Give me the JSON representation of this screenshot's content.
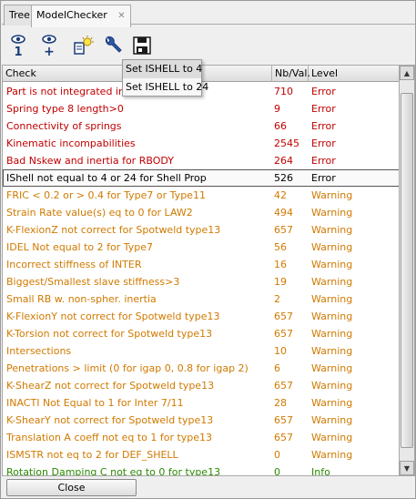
{
  "tabs": [
    {
      "label": "Tree",
      "active": false
    },
    {
      "label": "ModelChecker",
      "active": true,
      "close": "✕"
    }
  ],
  "toolbar": {
    "buttons": [
      {
        "name": "show-one-icon",
        "digit": "1"
      },
      {
        "name": "show-plus-icon",
        "digit": "+"
      },
      {
        "name": "lightbulb-icon"
      },
      {
        "name": "wrench-icon"
      },
      {
        "name": "save-icon"
      }
    ]
  },
  "table": {
    "columns": [
      "Check",
      "Nb/Val.",
      "Level"
    ],
    "rows": [
      {
        "check": "Part is not integrated in rbody",
        "nb": "710",
        "level": "Error",
        "sev": "error"
      },
      {
        "check": "Spring type 8 length>0",
        "nb": "9",
        "level": "Error",
        "sev": "error"
      },
      {
        "check": "Connectivity of springs",
        "nb": "66",
        "level": "Error",
        "sev": "error"
      },
      {
        "check": "Kinematic incompabilities",
        "nb": "2545",
        "level": "Error",
        "sev": "error"
      },
      {
        "check": "Bad Nskew and inertia for RBODY",
        "nb": "264",
        "level": "Error",
        "sev": "error"
      },
      {
        "check": "IShell not equal to 4 or 24 for Shell Prop",
        "nb": "526",
        "level": "Error",
        "sev": "selected",
        "selected": true
      },
      {
        "check": "FRIC < 0.2 or > 0.4 for Type7 or Type11",
        "nb": "42",
        "level": "Warning",
        "sev": "warning"
      },
      {
        "check": "Strain Rate value(s) eq to 0 for LAW2",
        "nb": "494",
        "level": "Warning",
        "sev": "warning"
      },
      {
        "check": "K-FlexionZ not correct for Spotweld type13",
        "nb": "657",
        "level": "Warning",
        "sev": "warning"
      },
      {
        "check": "IDEL Not equal to 2 for Type7",
        "nb": "56",
        "level": "Warning",
        "sev": "warning"
      },
      {
        "check": "Incorrect stiffness of INTER",
        "nb": "16",
        "level": "Warning",
        "sev": "warning"
      },
      {
        "check": "Biggest/Smallest slave stiffness>3",
        "nb": "19",
        "level": "Warning",
        "sev": "warning"
      },
      {
        "check": "Small RB w. non-spher. inertia",
        "nb": "2",
        "level": "Warning",
        "sev": "warning"
      },
      {
        "check": "K-FlexionY not correct for Spotweld type13",
        "nb": "657",
        "level": "Warning",
        "sev": "warning"
      },
      {
        "check": "K-Torsion not correct for Spotweld type13",
        "nb": "657",
        "level": "Warning",
        "sev": "warning"
      },
      {
        "check": "Intersections",
        "nb": "10",
        "level": "Warning",
        "sev": "warning"
      },
      {
        "check": "Penetrations > limit (0 for igap 0, 0.8 for igap 2)",
        "nb": "6",
        "level": "Warning",
        "sev": "warning"
      },
      {
        "check": "K-ShearZ not correct for Spotweld type13",
        "nb": "657",
        "level": "Warning",
        "sev": "warning"
      },
      {
        "check": "INACTI Not Equal to 1 for Inter 7/11",
        "nb": "28",
        "level": "Warning",
        "sev": "warning"
      },
      {
        "check": "K-ShearY not correct for Spotweld type13",
        "nb": "657",
        "level": "Warning",
        "sev": "warning"
      },
      {
        "check": "Translation A coeff not eq to 1 for type13",
        "nb": "657",
        "level": "Warning",
        "sev": "warning"
      },
      {
        "check": "ISMSTR not eq to 2 for DEF_SHELL",
        "nb": "0",
        "level": "Warning",
        "sev": "warning"
      },
      {
        "check": "Rotation Damping C not eq to 0 for type13",
        "nb": "0",
        "level": "Info",
        "sev": "info"
      }
    ]
  },
  "popup_menu": {
    "items": [
      {
        "label": "Set ISHELL to 4",
        "hover": true
      },
      {
        "label": "Set ISHELL to 24",
        "hover": false
      }
    ]
  },
  "footer": {
    "close_label": "Close"
  },
  "colors": {
    "error": "#c00000",
    "warning": "#d07a00",
    "info": "#2a8a00"
  }
}
